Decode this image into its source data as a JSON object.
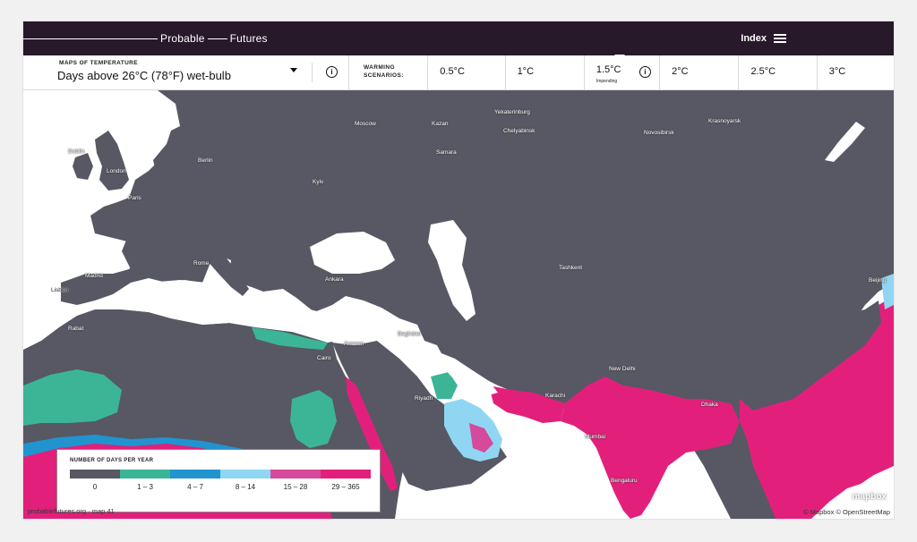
{
  "header": {
    "logo_left": "Probable",
    "logo_right": "Futures",
    "index_label": "Index"
  },
  "map_type": {
    "label": "MAPS OF TEMPERATURE",
    "value": "Days above 26°C (78°F) wet-bulb"
  },
  "warming": {
    "label_line1": "WARMING",
    "label_line2": "SCENARIOS:",
    "scenarios": [
      {
        "label": "0.5°C",
        "sub": ""
      },
      {
        "label": "1°C",
        "sub": ""
      },
      {
        "label": "1.5°C",
        "sub": "Impending"
      },
      {
        "label": "2°C",
        "sub": ""
      },
      {
        "label": "2.5°C",
        "sub": ""
      },
      {
        "label": "3°C",
        "sub": ""
      }
    ],
    "selected": "1.5°C"
  },
  "cities": [
    {
      "name": "Dublin"
    },
    {
      "name": "London"
    },
    {
      "name": "Paris"
    },
    {
      "name": "Berlin"
    },
    {
      "name": "Moscow"
    },
    {
      "name": "Kazan"
    },
    {
      "name": "Yekaterinburg"
    },
    {
      "name": "Chelyabinsk"
    },
    {
      "name": "Samara"
    },
    {
      "name": "Novosibirsk"
    },
    {
      "name": "Krasnoyarsk"
    },
    {
      "name": "Kyiv"
    },
    {
      "name": "Madrid"
    },
    {
      "name": "Lisbon"
    },
    {
      "name": "Rome"
    },
    {
      "name": "Ankara"
    },
    {
      "name": "Rabat"
    },
    {
      "name": "Amman"
    },
    {
      "name": "Cairo"
    },
    {
      "name": "Baghdad"
    },
    {
      "name": "Riyadh"
    },
    {
      "name": "Tashkent"
    },
    {
      "name": "Karachi"
    },
    {
      "name": "New Delhi"
    },
    {
      "name": "Dhaka"
    },
    {
      "name": "Mumbai"
    },
    {
      "name": "Bengaluru"
    },
    {
      "name": "Beijing"
    }
  ],
  "legend": {
    "title": "NUMBER OF DAYS PER YEAR",
    "items": [
      {
        "label": "0",
        "color": "#575863"
      },
      {
        "label": "1 – 3",
        "color": "#3bb596"
      },
      {
        "label": "4 – 7",
        "color": "#2194d0"
      },
      {
        "label": "8 – 14",
        "color": "#90d6f3"
      },
      {
        "label": "15 – 28",
        "color": "#d64a9c"
      },
      {
        "label": "29 – 365",
        "color": "#e2207c"
      }
    ]
  },
  "footer": {
    "source": "probablefutures.org · map 41",
    "attribution": "© Mapbox  © OpenStreetMap",
    "mapbox_logo": "mapbox"
  },
  "colors": {
    "topbar": "#27182a",
    "land_zero": "#575863",
    "water": "#ffffff"
  }
}
